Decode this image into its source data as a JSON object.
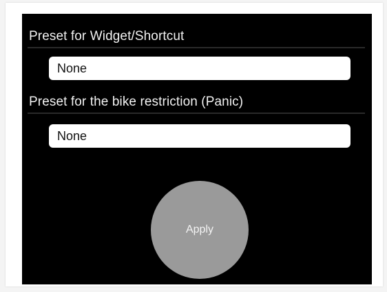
{
  "settings": {
    "widget_preset": {
      "label": "Preset for Widget/Shortcut",
      "value": "None"
    },
    "panic_preset": {
      "label": "Preset for the bike restriction (Panic)",
      "value": "None"
    }
  },
  "actions": {
    "apply_label": "Apply"
  },
  "colors": {
    "background": "#000000",
    "text": "#f2f2f2",
    "field": "#ffffff",
    "button": "#9a9a9a"
  }
}
